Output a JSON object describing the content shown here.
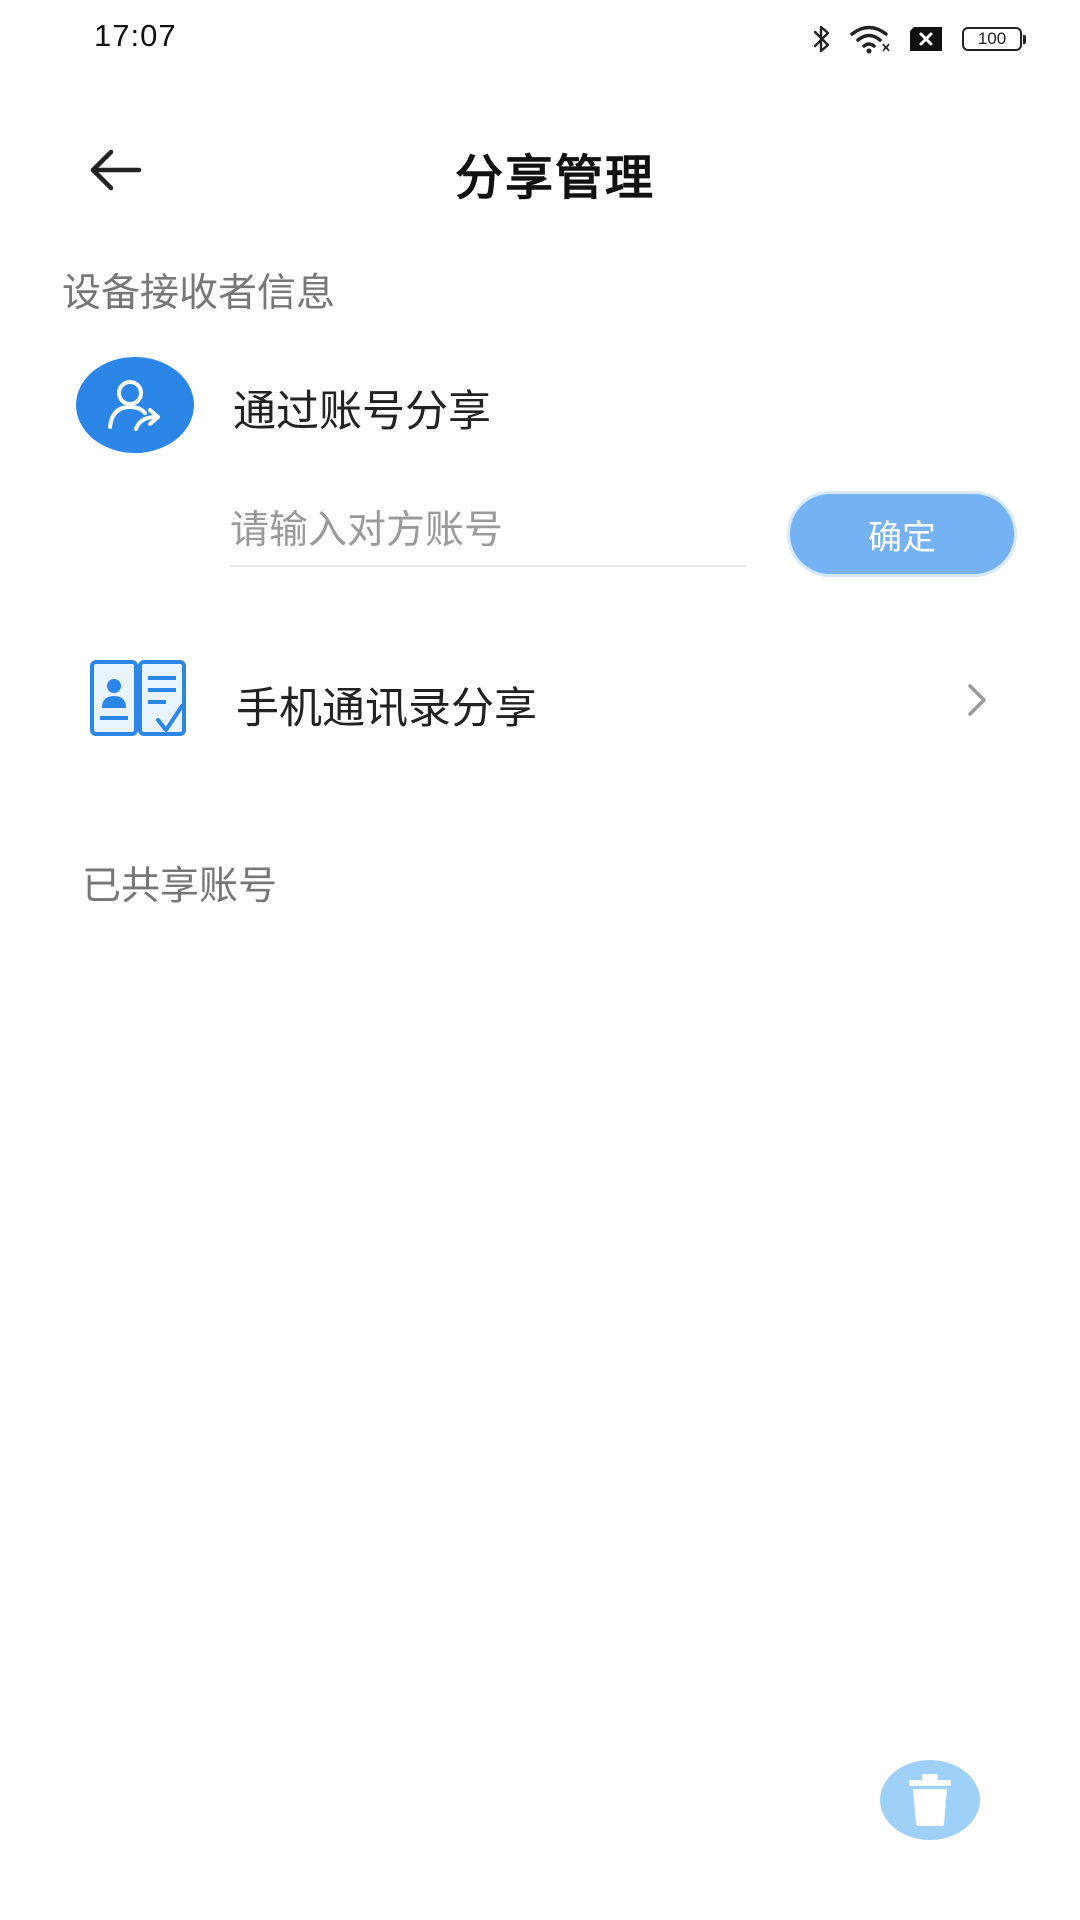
{
  "status_bar": {
    "time": "17:07",
    "battery": "100",
    "icons": [
      "bluetooth-icon",
      "wifi-icon",
      "sim-off-icon",
      "battery-icon"
    ]
  },
  "header": {
    "back_icon": "arrow-left-icon",
    "title": "分享管理"
  },
  "receiver_section": {
    "title": "设备接收者信息",
    "account_share": {
      "icon": "user-share-icon",
      "label": "通过账号分享",
      "input_placeholder": "请输入对方账号",
      "input_value": "",
      "confirm_label": "确定"
    },
    "contacts_share": {
      "icon": "contacts-book-icon",
      "label": "手机通讯录分享",
      "chevron_icon": "chevron-right-icon"
    }
  },
  "shared_section": {
    "title": "已共享账号",
    "items": []
  },
  "fab": {
    "icon": "trash-icon"
  },
  "colors": {
    "accent": "#2b86e8",
    "confirm_button": "#74b2f4",
    "trash_button": "#9fd1f8",
    "section_title": "#777777"
  }
}
